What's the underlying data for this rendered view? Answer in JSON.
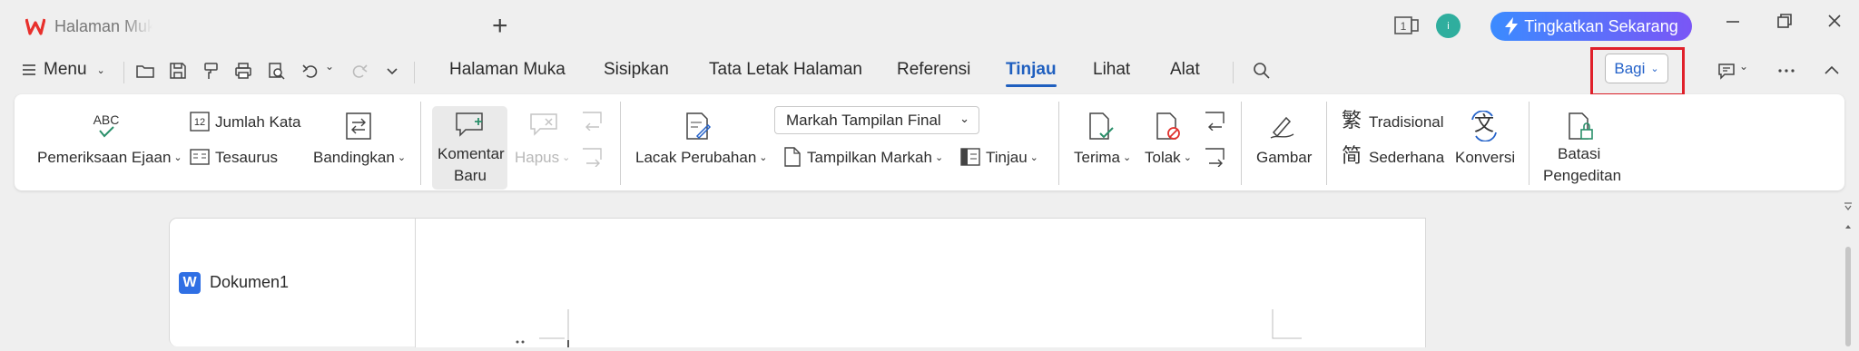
{
  "tabs": {
    "home_label": "Halaman Muka",
    "doc_label": "Dokumen1",
    "new_tab": "+"
  },
  "titlebar": {
    "upgrade_label": "Tingkatkan Sekarang",
    "avatar_initial": "i",
    "page_badge": "1"
  },
  "menu": {
    "menu_label": "Menu",
    "items": [
      "Halaman Muka",
      "Sisipkan",
      "Tata Letak Halaman",
      "Referensi",
      "Tinjau",
      "Lihat",
      "Alat"
    ],
    "active": "Tinjau",
    "share_label": "Bagi"
  },
  "ribbon": {
    "spelling": "Pemeriksaan Ejaan",
    "word_count": "Jumlah Kata",
    "thesaurus": "Tesaurus",
    "compare": "Bandingkan",
    "new_comment_1": "Komentar",
    "new_comment_2": "Baru",
    "delete": "Hapus",
    "track_changes": "Lacak Perubahan",
    "markup_select": "Markah Tampilan Final",
    "show_markup": "Tampilkan Markah",
    "review": "Tinjau",
    "accept": "Terima",
    "reject": "Tolak",
    "ink": "Gambar",
    "traditional": "Tradisional",
    "simplified": "Sederhana",
    "convert": "Konversi",
    "restrict_1": "Batasi",
    "restrict_2": "Pengeditan"
  },
  "colors": {
    "accent": "#1f5fbf",
    "highlight_box": "#e0202a",
    "upgrade_gradient_start": "#3b8bff",
    "upgrade_gradient_end": "#7a56f6"
  }
}
